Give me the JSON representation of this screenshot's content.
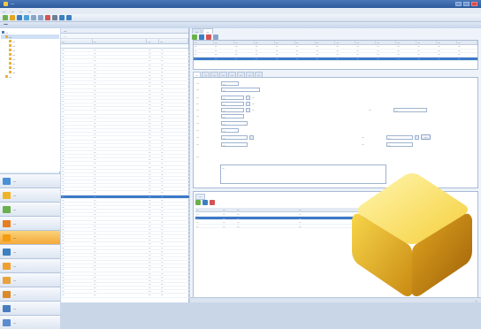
{
  "window": {
    "title": "—"
  },
  "menu": [
    "—",
    "—",
    "—",
    "—"
  ],
  "toolbar": {
    "icons": [
      "new-icon",
      "open-icon",
      "save-icon",
      "refresh-icon",
      "copy-icon",
      "paste-icon",
      "delete-icon",
      "print-icon",
      "search-icon",
      "help-icon"
    ]
  },
  "section": {
    "title": "—"
  },
  "tree": [
    {
      "label": "—",
      "level": 0,
      "selected": false
    },
    {
      "label": "—",
      "level": 1,
      "selected": true
    },
    {
      "label": "—",
      "level": 2,
      "selected": false
    },
    {
      "label": "—",
      "level": 2,
      "selected": false
    },
    {
      "label": "—",
      "level": 2,
      "selected": false
    },
    {
      "label": "—",
      "level": 2,
      "selected": false
    },
    {
      "label": "—",
      "level": 2,
      "selected": false
    },
    {
      "label": "—",
      "level": 2,
      "selected": false
    },
    {
      "label": "—",
      "level": 2,
      "selected": false
    },
    {
      "label": "—",
      "level": 2,
      "selected": false
    },
    {
      "label": "—",
      "level": 1,
      "selected": false
    }
  ],
  "nav": [
    {
      "label": "—",
      "color": "#4b8fd6"
    },
    {
      "label": "—",
      "color": "#f0b429"
    },
    {
      "label": "—",
      "color": "#6ab04c"
    },
    {
      "label": "—",
      "color": "#e67e22"
    },
    {
      "label": "—",
      "color": "#f39c12",
      "active": true
    },
    {
      "label": "—",
      "color": "#3d7fc1"
    },
    {
      "label": "—",
      "color": "#f0a030"
    },
    {
      "label": "—",
      "color": "#e8a33c"
    },
    {
      "label": "—",
      "color": "#d98a2b"
    },
    {
      "label": "—",
      "color": "#4a7dbf"
    },
    {
      "label": "—",
      "color": "#5b8bd0"
    }
  ],
  "list": {
    "tab": "—",
    "group_hint": "—",
    "headers": [
      "—",
      "—",
      "—",
      "—"
    ],
    "rows": [
      [
        "—",
        "—",
        "—",
        "—"
      ],
      [
        "—",
        "—",
        "—",
        "—"
      ],
      [
        "—",
        "—",
        "—",
        "—"
      ],
      [
        "—",
        "—",
        "—",
        "—"
      ],
      [
        "—",
        "—",
        "—",
        "—"
      ],
      [
        "—",
        "—",
        "—",
        "—"
      ],
      [
        "—",
        "—",
        "—",
        "—"
      ],
      [
        "—",
        "—",
        "—",
        "—"
      ],
      [
        "—",
        "—",
        "—",
        "—"
      ],
      [
        "—",
        "—",
        "—",
        "—"
      ],
      [
        "—",
        "—",
        "—",
        "—"
      ],
      [
        "—",
        "—",
        "—",
        "—"
      ],
      [
        "—",
        "—",
        "—",
        "—"
      ],
      [
        "—",
        "—",
        "—",
        "—"
      ],
      [
        "—",
        "—",
        "—",
        "—"
      ],
      [
        "—",
        "—",
        "—",
        "—"
      ],
      [
        "—",
        "—",
        "—",
        "—"
      ],
      [
        "—",
        "—",
        "—",
        "—"
      ],
      [
        "—",
        "—",
        "—",
        "—"
      ],
      [
        "—",
        "—",
        "—",
        "—"
      ],
      [
        "—",
        "—",
        "—",
        "—"
      ],
      [
        "—",
        "—",
        "—",
        "—"
      ],
      [
        "—",
        "—",
        "—",
        "—"
      ],
      [
        "—",
        "—",
        "—",
        "—"
      ],
      [
        "—",
        "—",
        "—",
        "—"
      ],
      [
        "—",
        "—",
        "—",
        "—"
      ],
      [
        "—",
        "—",
        "—",
        "—"
      ],
      [
        "—",
        "—",
        "—",
        "—"
      ],
      [
        "—",
        "—",
        "—",
        "—"
      ],
      [
        "—",
        "—",
        "—",
        "—"
      ],
      [
        "—",
        "—",
        "—",
        "—"
      ],
      [
        "—",
        "—",
        "—",
        "—"
      ],
      [
        "—",
        "—",
        "—",
        "—"
      ],
      [
        "—",
        "—",
        "—",
        "—"
      ],
      [
        "—",
        "—",
        "—",
        "—"
      ],
      [
        "—",
        "—",
        "—",
        "—"
      ],
      [
        "—",
        "—",
        "—",
        "—"
      ],
      [
        "—",
        "—",
        "—",
        "—"
      ],
      [
        "—",
        "—",
        "—",
        "—"
      ],
      [
        "—",
        "—",
        "—",
        "—"
      ],
      [
        "—",
        "—",
        "—",
        "—"
      ],
      [
        "—",
        "—",
        "—",
        "—"
      ],
      [
        "—",
        "—",
        "—",
        "—"
      ],
      [
        "—",
        "—",
        "—",
        "—"
      ],
      [
        "—",
        "—",
        "—",
        "—"
      ],
      [
        "—",
        "—",
        "—",
        "—"
      ],
      [
        "—",
        "—",
        "—",
        "—"
      ],
      [
        "—",
        "—",
        "—",
        "—"
      ],
      [
        "—",
        "—",
        "—",
        "—"
      ],
      [
        "—",
        "—",
        "—",
        "—"
      ],
      [
        "—",
        "—",
        "—",
        "—"
      ],
      [
        "—",
        "—",
        "—",
        "—"
      ],
      [
        "—",
        "—",
        "—",
        "—"
      ],
      [
        "—",
        "—",
        "—",
        "—"
      ],
      [
        "—",
        "—",
        "—",
        "—"
      ],
      [
        "—",
        "—",
        "—",
        "—"
      ],
      [
        "—",
        "—",
        "—",
        "—"
      ],
      [
        "—",
        "—",
        "—",
        "—"
      ],
      [
        "—",
        "—",
        "—",
        "—"
      ],
      [
        "—",
        "—",
        "—",
        "—"
      ],
      [
        "—",
        "—",
        "—",
        "—"
      ],
      [
        "—",
        "—",
        "—",
        "—"
      ],
      [
        "—",
        "—",
        "—",
        "—"
      ],
      [
        "—",
        "—",
        "—",
        "—"
      ],
      [
        "—",
        "—",
        "—",
        "—"
      ],
      [
        "—",
        "—",
        "—",
        "—"
      ],
      [
        "—",
        "—",
        "—",
        "—"
      ],
      [
        "—",
        "—",
        "—",
        "—"
      ]
    ],
    "selected_row": 40
  },
  "detail": {
    "tabs": [
      "—",
      "—"
    ],
    "grid_headers": [
      "—",
      "—",
      "—",
      "—",
      "—",
      "—",
      "—",
      "—",
      "—",
      "—",
      "—",
      "—",
      "—",
      "—"
    ],
    "grid_rows": [
      [
        "—",
        "—",
        "—",
        "—",
        "—",
        "—",
        "—",
        "—",
        "—",
        "—",
        "—",
        "—",
        "—",
        "—"
      ],
      [
        "—",
        "—",
        "—",
        "—",
        "—",
        "—",
        "—",
        "—",
        "—",
        "—",
        "—",
        "—",
        "—",
        "—"
      ],
      [
        "—",
        "—",
        "—",
        "—",
        "—",
        "—",
        "—",
        "—",
        "—",
        "—",
        "—",
        "—",
        "—",
        "—"
      ],
      [
        "—",
        "—",
        "—",
        "—",
        "—",
        "—",
        "—",
        "—",
        "—",
        "—",
        "—",
        "—",
        "—",
        "—"
      ]
    ],
    "grid_selected": 3,
    "sub_tabs": [
      "—",
      "—",
      "—",
      "—",
      "—",
      "—",
      "—",
      "—"
    ],
    "form": {
      "f1_label": "—",
      "f1_value": "—",
      "f2_label": "—",
      "f2_value": "—",
      "f3_label": "—",
      "f3_value": "—",
      "f3_note": "—",
      "f4_label": "—",
      "f4_value": "—",
      "f4_note": "—",
      "f5_label": "—",
      "f5_value": "—",
      "f5_note": "—",
      "f5_right_label": "—",
      "f5_right_value": "—",
      "f6_label": "—",
      "f6_value": "—",
      "f7_label": "—",
      "f7_value": "—",
      "f8_label": "—",
      "f8_value": "—",
      "f9_label": "—",
      "f9_value": "—",
      "f9_right_label": "—",
      "f9_right_value": "—",
      "f9_button": "—",
      "f10_label": "—",
      "f10_value": "—",
      "f10_right_label": "—",
      "f10_right_value": "—",
      "notes_label": "—",
      "notes_value": "—"
    }
  },
  "bottom": {
    "tab": "—",
    "headers": [
      "—",
      "—",
      "—",
      "—"
    ],
    "rows": [
      [
        "—",
        "—",
        "—",
        "—"
      ],
      [
        "—",
        "—",
        "—",
        "—"
      ],
      [
        "—",
        "—",
        "—",
        "—"
      ],
      [
        "—",
        "—",
        "—",
        "—"
      ]
    ],
    "selected_row": 1
  },
  "status": {
    "text": "—"
  }
}
